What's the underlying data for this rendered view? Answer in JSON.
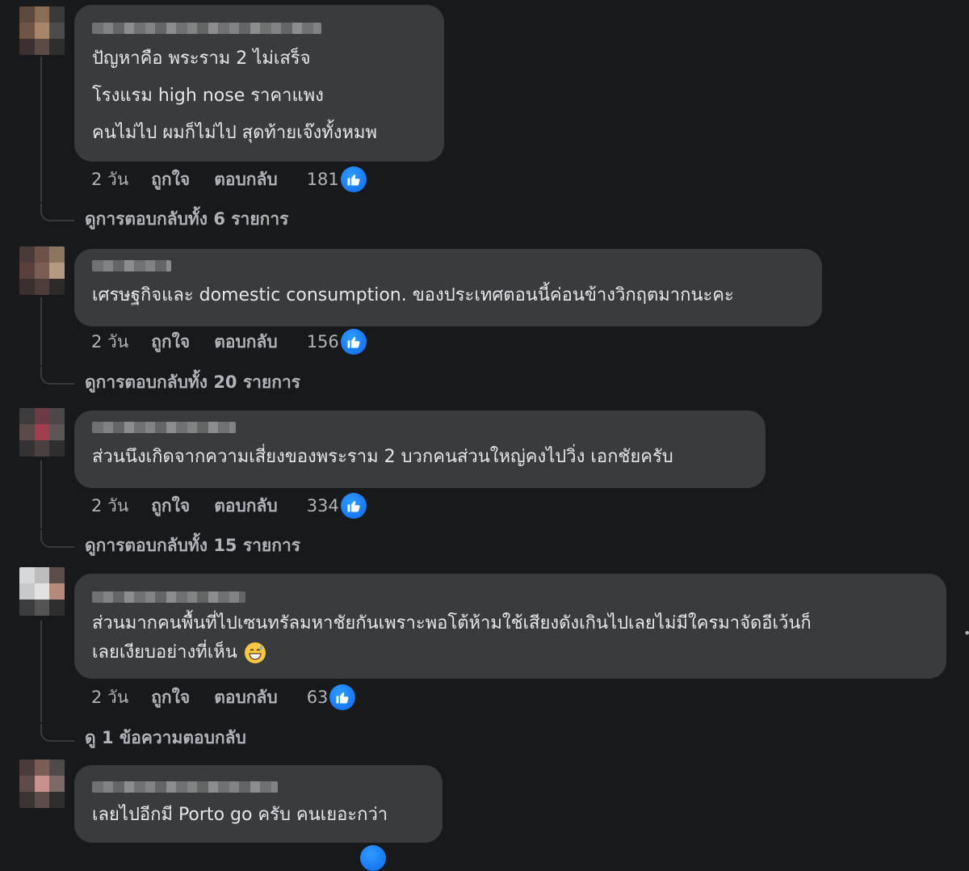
{
  "comments": [
    {
      "lines": [
        "ปัญหาคือ พระราม 2 ไม่เสร็จ",
        "โรงแรม high nose ราคาแพง",
        "คนไม่ไป ผมก็ไม่ไป สุดท้ายเจ๊งทั้งหมพ"
      ],
      "time": "2 วัน",
      "like_label": "ถูกใจ",
      "reply_label": "ตอบกลับ",
      "likes": "181",
      "view_replies": "ดูการตอบกลับทั้ง 6 รายการ"
    },
    {
      "lines": [
        "เศรษฐกิจและ domestic consumption. ของประเทศตอนนี้ค่อนข้างวิกฤตมากนะคะ"
      ],
      "time": "2 วัน",
      "like_label": "ถูกใจ",
      "reply_label": "ตอบกลับ",
      "likes": "156",
      "view_replies": "ดูการตอบกลับทั้ง 20 รายการ"
    },
    {
      "lines": [
        "ส่วนนึงเกิดจากความเสี่ยงของพระราม 2 บวกคนส่วนใหญ่คงไปวิ่ง เอกชัยครับ"
      ],
      "time": "2 วัน",
      "like_label": "ถูกใจ",
      "reply_label": "ตอบกลับ",
      "likes": "334",
      "view_replies": "ดูการตอบกลับทั้ง 15 รายการ"
    },
    {
      "lines": [
        "ส่วนมากคนพื้นที่ไปเซนทรัลมหาชัยกันเพราะพอโต้ห้ามใช้เสียงดังเกินไปเลยไม่มีใครมาจัดอีเว้นก็",
        "เลยเงียบอย่างที่เห็น"
      ],
      "time": "2 วัน",
      "like_label": "ถูกใจ",
      "reply_label": "ตอบกลับ",
      "likes": "63",
      "view_replies": "ดู 1 ข้อความตอบกลับ"
    },
    {
      "lines": [
        "เลยไปอีกมี Porto go ครับ คนเยอะกว่า"
      ]
    }
  ],
  "icons": {
    "like": "thumbs-up-icon",
    "emoji": "grinning-sweat-emoji"
  },
  "colors": {
    "background": "#18191a",
    "bubble": "#3a3b3c",
    "like_blue": "#1877f2",
    "muted_text": "#b0b3b8"
  }
}
